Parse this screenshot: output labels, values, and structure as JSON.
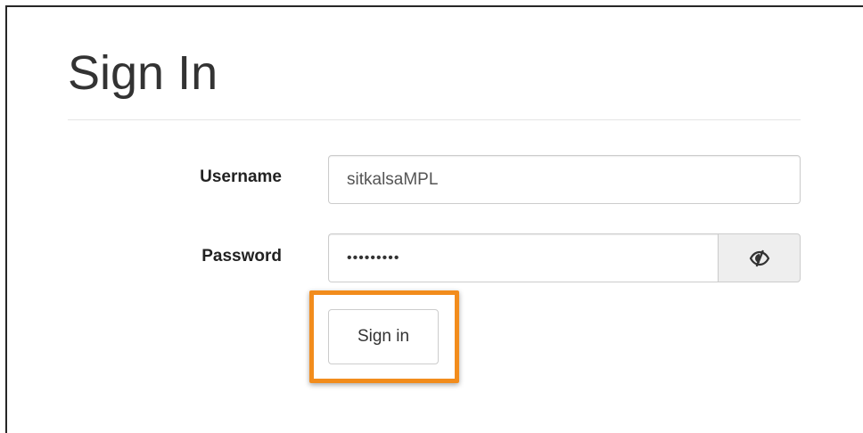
{
  "page": {
    "title": "Sign In"
  },
  "form": {
    "username_label": "Username",
    "username_value": "sitkalsaMPL",
    "password_label": "Password",
    "password_value": "sitkalsaM",
    "show_password_icon": "eye-slash-icon",
    "submit_label": "Sign in"
  },
  "colors": {
    "highlight": "#f28c1c",
    "text": "#333333",
    "addon_bg": "#eeeeee",
    "input_border": "#cccccc"
  }
}
